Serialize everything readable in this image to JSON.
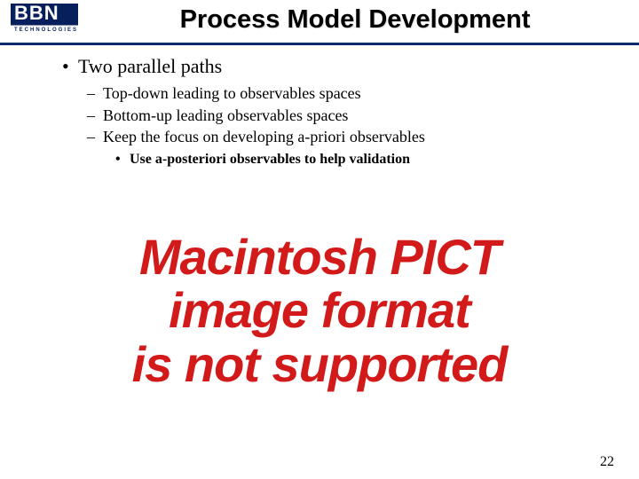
{
  "logo": {
    "name": "BBN",
    "subtitle": "TECHNOLOGIES"
  },
  "title": "Process Model Development",
  "bullets": {
    "level1": "Two parallel paths",
    "level2": [
      "Top-down leading to observables spaces",
      "Bottom-up leading observables spaces",
      "Keep the focus on developing a-priori observables"
    ],
    "level3": "Use a-posteriori observables to help validation"
  },
  "error_text": {
    "line1": "Macintosh PICT",
    "line2": "image format",
    "line3": "is not supported"
  },
  "page_number": "22"
}
